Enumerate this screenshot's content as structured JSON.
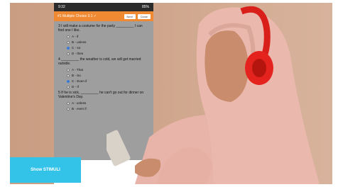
{
  "status": {
    "time": "9:32",
    "right": "85%"
  },
  "appbar": {
    "title": "#1 Multiple Choice 3.1 ✓",
    "btn1": "Next",
    "btn2": "Close"
  },
  "questions": [
    {
      "text": "3  I will make a costume for the party _________ I can find one I like.",
      "options": [
        {
          "label": "A - if",
          "selected": false
        },
        {
          "label": "B - unless",
          "selected": false
        },
        {
          "label": "C - so",
          "selected": true
        },
        {
          "label": "D - then",
          "selected": false
        }
      ]
    },
    {
      "text": "4  _________ the weather is cold, we will get married outside.",
      "options": [
        {
          "label": "A - That",
          "selected": false
        },
        {
          "label": "B - So",
          "selected": false
        },
        {
          "label": "C - Even if",
          "selected": true
        },
        {
          "label": "D - If",
          "selected": false
        }
      ]
    },
    {
      "text": "5  If he is sick, _________ he can't go out for dinner on Valentine's Day.",
      "options": [
        {
          "label": "A - unless",
          "selected": false
        },
        {
          "label": "B - even if",
          "selected": false
        }
      ]
    }
  ],
  "show_button": "Show STIMULI",
  "colors": {
    "accent": "#ef8a33",
    "button": "#33c3e8",
    "headphones": "#e4231e",
    "hijab": "#eab8ad"
  }
}
